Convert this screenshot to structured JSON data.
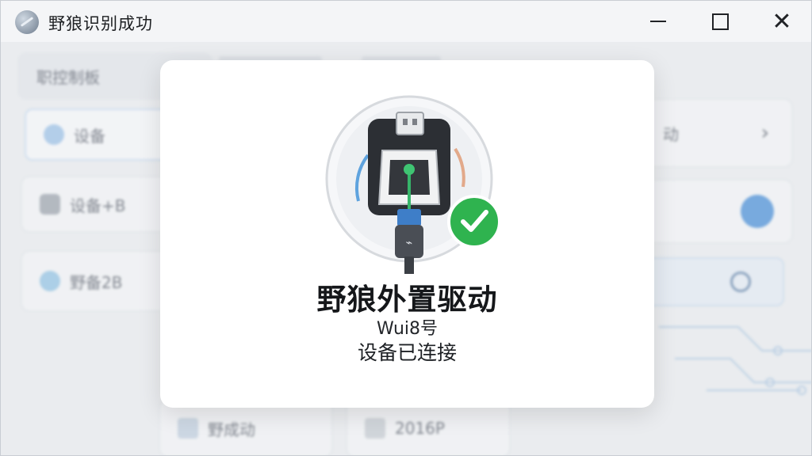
{
  "window": {
    "title": "野狼识别成功",
    "close_glyph": "✕"
  },
  "background": {
    "top_tab": "职控制板",
    "sidebar": [
      {
        "label": "设备"
      },
      {
        "label": "设备+B"
      },
      {
        "label": "野备2B"
      }
    ],
    "right_label": "动",
    "right_chevron": "›",
    "bottom_left": "野成动",
    "bottom_right": "2016P"
  },
  "dialog": {
    "title": "野狼外置驱动",
    "subtitle": "Wui8号",
    "status": "设备已连接",
    "icon": "usb-device-connected-icon",
    "check_icon": "check-circle-icon"
  },
  "colors": {
    "success": "#2fb34f",
    "accent": "#4a8fd6",
    "usb_cable": "#3e7ec8"
  }
}
